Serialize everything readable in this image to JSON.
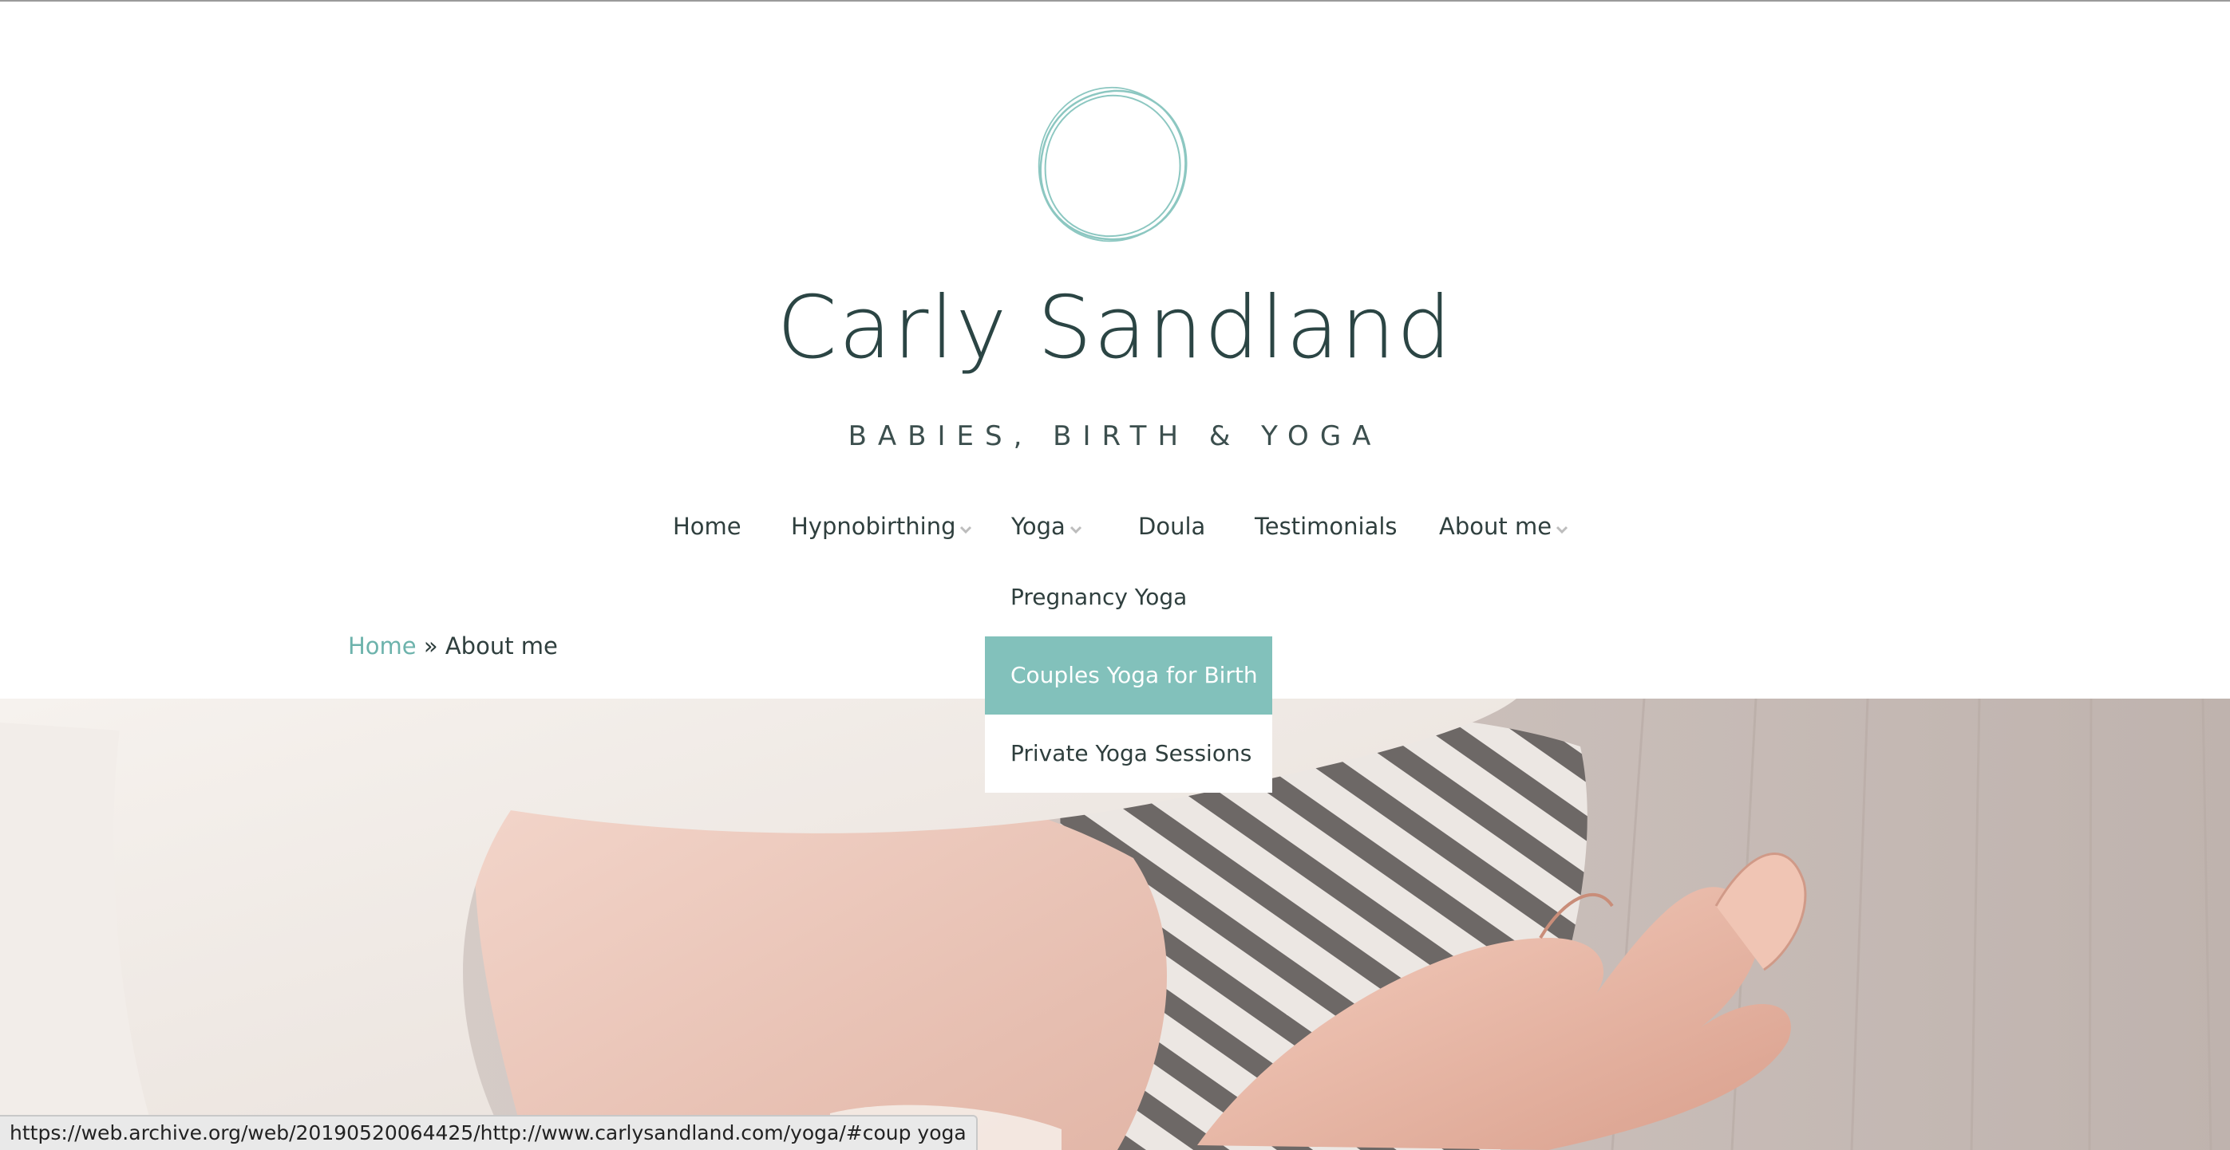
{
  "colors": {
    "accent": "#82c1bb",
    "link": "#6db3ac",
    "title": "#2b4544",
    "text": "#2f3f3e"
  },
  "header": {
    "logo_icon": "hand-drawn-circle-icon",
    "title": "Carly Sandland",
    "tagline": "BABIES, BIRTH & YOGA"
  },
  "nav": {
    "items": [
      {
        "label": "Home",
        "has_submenu": false
      },
      {
        "label": "Hypnobirthing",
        "has_submenu": true
      },
      {
        "label": "Yoga",
        "has_submenu": true
      },
      {
        "label": "Doula",
        "has_submenu": false
      },
      {
        "label": "Testimonials",
        "has_submenu": false
      },
      {
        "label": "About me",
        "has_submenu": true
      }
    ],
    "chevron_icon": "chevron-down-icon"
  },
  "yoga_dropdown": {
    "items": [
      {
        "label": "Pregnancy Yoga",
        "active": false
      },
      {
        "label": "Couples Yoga for Birth",
        "active": true
      },
      {
        "label": "Private Yoga Sessions",
        "active": false
      }
    ]
  },
  "breadcrumb": {
    "home": "Home",
    "separator": "»",
    "current": "About me"
  },
  "status_bar": {
    "url": "https://web.archive.org/web/20190520064425/http://www.carlysandland.com/yoga/#coup yoga"
  }
}
